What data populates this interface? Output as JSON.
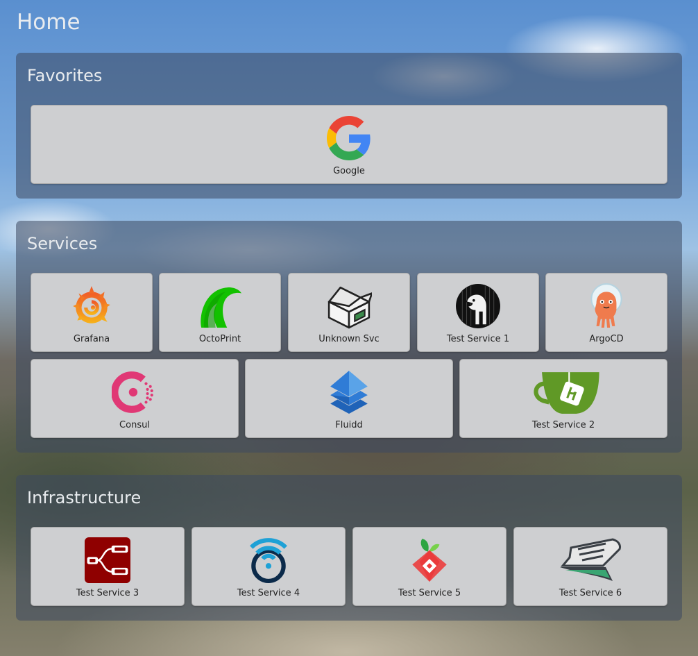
{
  "page": {
    "title": "Home"
  },
  "groups": {
    "favorites": {
      "title": "Favorites",
      "tiles": [
        {
          "label": "Google",
          "icon": "google-icon"
        }
      ]
    },
    "services": {
      "title": "Services",
      "tiles": [
        {
          "label": "Grafana",
          "icon": "grafana-icon"
        },
        {
          "label": "OctoPrint",
          "icon": "octoprint-icon"
        },
        {
          "label": "Unknown Svc",
          "icon": "unknown-box-icon"
        },
        {
          "label": "Test Service 1",
          "icon": "postgres-icon"
        },
        {
          "label": "ArgoCD",
          "icon": "argocd-icon"
        },
        {
          "label": "Consul",
          "icon": "consul-icon"
        },
        {
          "label": "Fluidd",
          "icon": "fluidd-icon"
        },
        {
          "label": "Test Service 2",
          "icon": "gitea-icon"
        }
      ]
    },
    "infrastructure": {
      "title": "Infrastructure",
      "tiles": [
        {
          "label": "Test Service 3",
          "icon": "node-red-icon"
        },
        {
          "label": "Test Service 4",
          "icon": "wifi-icon"
        },
        {
          "label": "Test Service 5",
          "icon": "pihole-icon"
        },
        {
          "label": "Test Service 6",
          "icon": "ship-icon"
        }
      ]
    }
  },
  "colors": {
    "panel": "#3c4860",
    "tile": "#cecfd1",
    "title_text": "#e9ecef"
  }
}
